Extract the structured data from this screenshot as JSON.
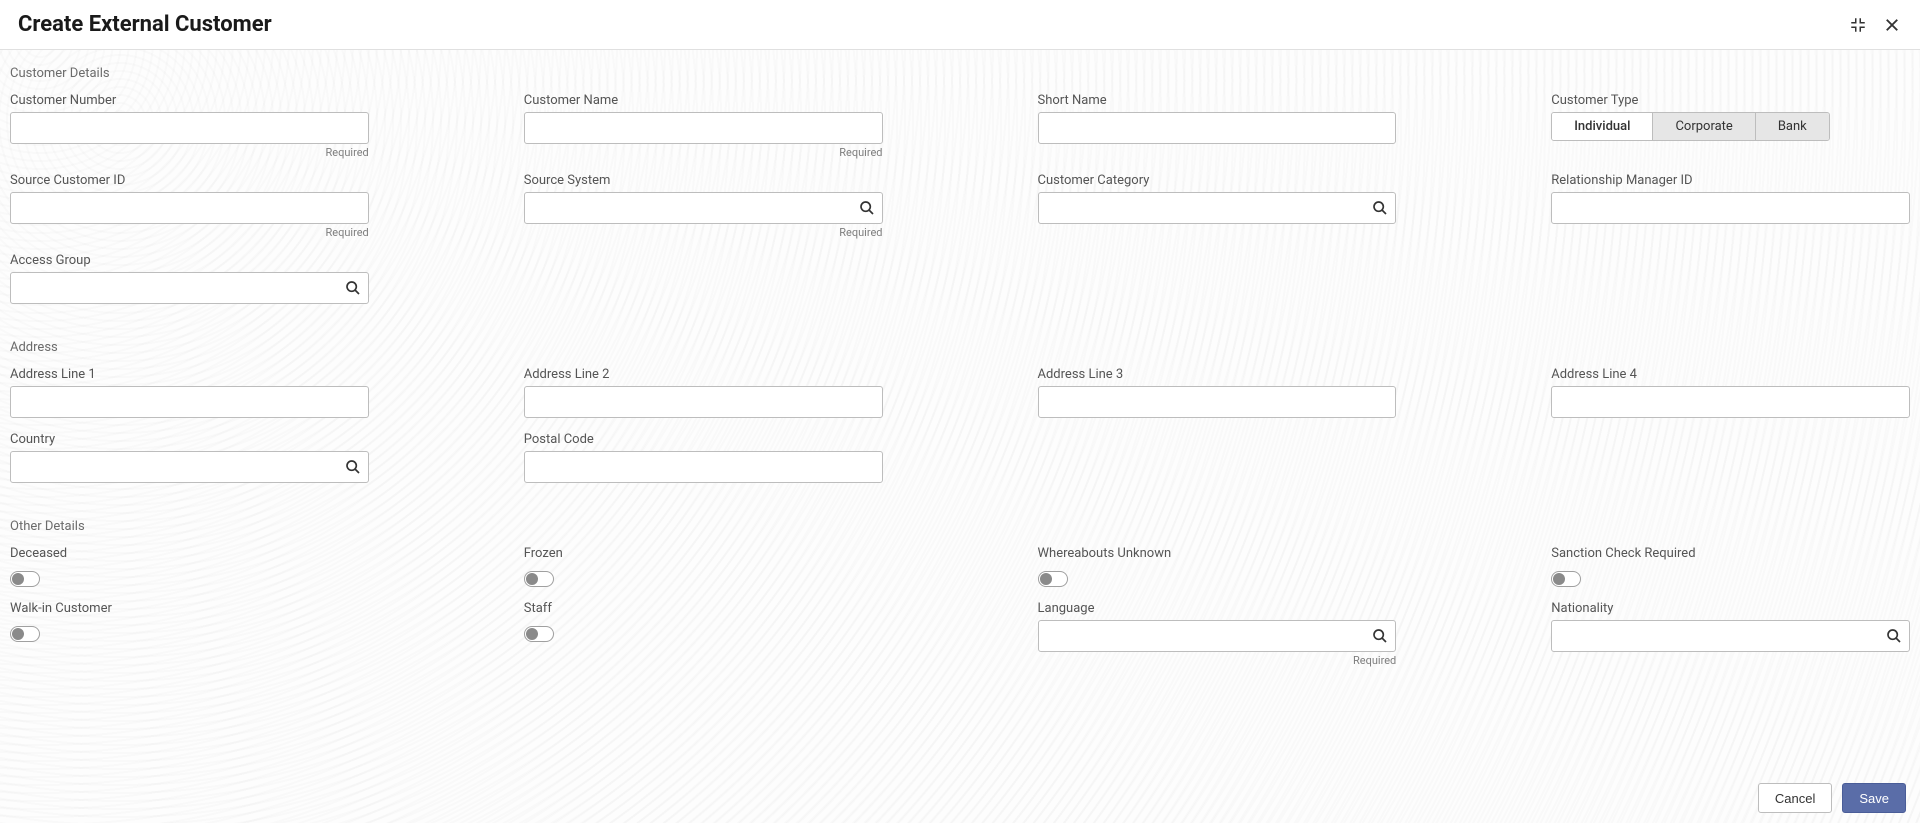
{
  "header": {
    "title": "Create External Customer"
  },
  "sections": {
    "customer_details": "Customer Details",
    "address": "Address",
    "other_details": "Other Details"
  },
  "fields": {
    "customer_number": {
      "label": "Customer Number",
      "helper": "Required"
    },
    "customer_name": {
      "label": "Customer Name",
      "helper": "Required"
    },
    "short_name": {
      "label": "Short Name"
    },
    "customer_type": {
      "label": "Customer Type",
      "options": {
        "individual": "Individual",
        "corporate": "Corporate",
        "bank": "Bank"
      }
    },
    "source_customer_id": {
      "label": "Source Customer ID",
      "helper": "Required"
    },
    "source_system": {
      "label": "Source System",
      "helper": "Required"
    },
    "customer_category": {
      "label": "Customer Category"
    },
    "relationship_manager_id": {
      "label": "Relationship Manager ID"
    },
    "access_group": {
      "label": "Access Group"
    },
    "address_line_1": {
      "label": "Address Line 1"
    },
    "address_line_2": {
      "label": "Address Line 2"
    },
    "address_line_3": {
      "label": "Address Line 3"
    },
    "address_line_4": {
      "label": "Address Line 4"
    },
    "country": {
      "label": "Country"
    },
    "postal_code": {
      "label": "Postal Code"
    },
    "deceased": {
      "label": "Deceased"
    },
    "frozen": {
      "label": "Frozen"
    },
    "whereabouts_unknown": {
      "label": "Whereabouts Unknown"
    },
    "sanction_check_required": {
      "label": "Sanction Check Required"
    },
    "walk_in_customer": {
      "label": "Walk-in Customer"
    },
    "staff": {
      "label": "Staff"
    },
    "language": {
      "label": "Language",
      "helper": "Required"
    },
    "nationality": {
      "label": "Nationality"
    }
  },
  "footer": {
    "cancel": "Cancel",
    "save": "Save"
  }
}
